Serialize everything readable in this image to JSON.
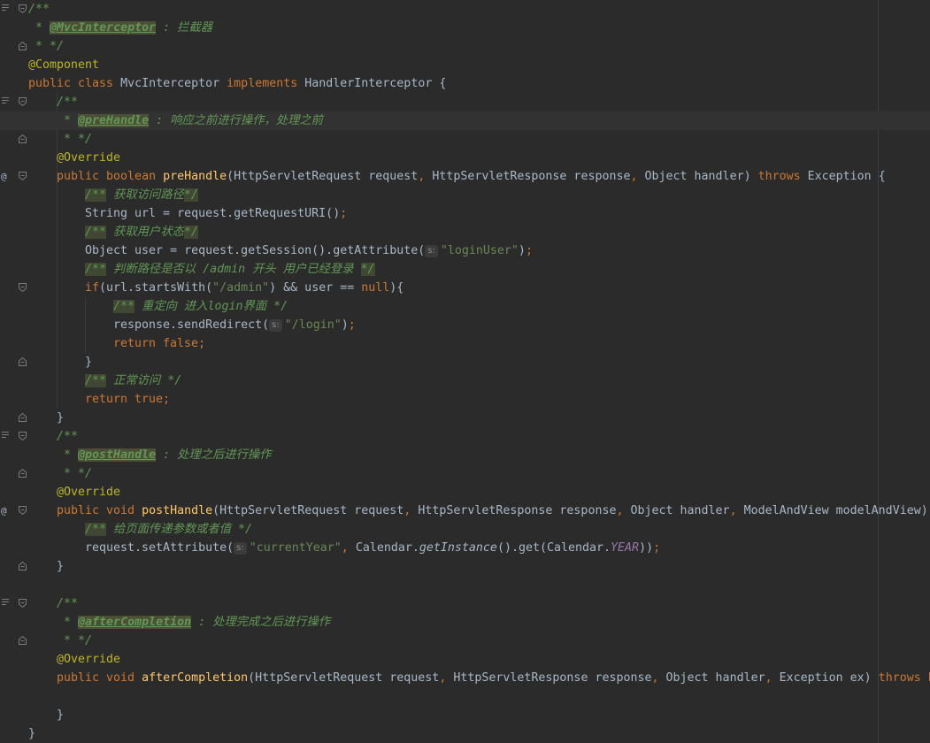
{
  "editor": {
    "lines": [
      {
        "gutter": "doc",
        "fold": "open",
        "indent": 0,
        "tokens": [
          {
            "t": "/**",
            "c": "doc"
          }
        ]
      },
      {
        "indent": 0,
        "tokens": [
          {
            "t": " * ",
            "c": "doc"
          },
          {
            "t": "@MvcInterceptor",
            "c": "doctag"
          },
          {
            "t": " : 拦截器",
            "c": "doc"
          }
        ]
      },
      {
        "fold": "close",
        "indent": 0,
        "tokens": [
          {
            "t": " * */",
            "c": "doc"
          }
        ]
      },
      {
        "indent": 0,
        "tokens": [
          {
            "t": "@Component",
            "c": "ann"
          }
        ]
      },
      {
        "indent": 0,
        "tokens": [
          {
            "t": "public class ",
            "c": "kw"
          },
          {
            "t": "MvcInterceptor "
          },
          {
            "t": "implements ",
            "c": "kw"
          },
          {
            "t": "HandlerInterceptor {"
          }
        ]
      },
      {
        "gutter": "doc",
        "fold": "open",
        "indent": 1,
        "tokens": [
          {
            "t": "/**",
            "c": "doc"
          }
        ]
      },
      {
        "current": true,
        "indent": 1,
        "tokens": [
          {
            "t": " * ",
            "c": "doc"
          },
          {
            "t": "@preHandle",
            "c": "doctag"
          },
          {
            "t": " : 响应之前进行操作，处理之前",
            "c": "doc"
          }
        ]
      },
      {
        "fold": "close",
        "indent": 1,
        "tokens": [
          {
            "t": " * */",
            "c": "doc"
          }
        ]
      },
      {
        "indent": 1,
        "tokens": [
          {
            "t": "@Override",
            "c": "ann"
          }
        ]
      },
      {
        "gutter": "@",
        "fold": "open",
        "indent": 1,
        "tokens": [
          {
            "t": "public boolean ",
            "c": "kw"
          },
          {
            "t": "preHandle",
            "c": "fn"
          },
          {
            "t": "(HttpServletRequest request"
          },
          {
            "t": ", ",
            "c": "kw"
          },
          {
            "t": "HttpServletResponse response"
          },
          {
            "t": ", ",
            "c": "kw"
          },
          {
            "t": "Object handler) "
          },
          {
            "t": "throws ",
            "c": "kw"
          },
          {
            "t": "Exception {"
          }
        ]
      },
      {
        "indent": 2,
        "tokens": [
          {
            "t": "/**",
            "c": "doc docmark"
          },
          {
            "t": " 获取访问路径",
            "c": "doc"
          },
          {
            "t": "*/",
            "c": "doc docmark"
          }
        ]
      },
      {
        "indent": 2,
        "tokens": [
          {
            "t": "String url = request.getRequestURI()"
          },
          {
            "t": ";",
            "c": "kw"
          }
        ]
      },
      {
        "indent": 2,
        "tokens": [
          {
            "t": "/**",
            "c": "doc docmark"
          },
          {
            "t": " 获取用户状态",
            "c": "doc"
          },
          {
            "t": "*/",
            "c": "doc docmark"
          }
        ]
      },
      {
        "indent": 2,
        "tokens": [
          {
            "t": "Object user = request.getSession().getAttribute("
          },
          {
            "hint": "s:"
          },
          {
            "t": "\"loginUser\"",
            "c": "str"
          },
          {
            "t": ")"
          },
          {
            "t": ";",
            "c": "kw"
          }
        ]
      },
      {
        "indent": 2,
        "tokens": [
          {
            "t": "/**",
            "c": "doc docmark"
          },
          {
            "t": " 判断路径是否以 /admin 开头 用户已经登录 ",
            "c": "doc"
          },
          {
            "t": "*/",
            "c": "doc docmark"
          }
        ]
      },
      {
        "fold": "open",
        "indent": 2,
        "tokens": [
          {
            "t": "if",
            "c": "kw"
          },
          {
            "t": "(url.startsWith("
          },
          {
            "t": "\"/admin\"",
            "c": "str"
          },
          {
            "t": ") && user == "
          },
          {
            "t": "null",
            "c": "kw"
          },
          {
            "t": "){"
          }
        ]
      },
      {
        "indent": 3,
        "tokens": [
          {
            "t": "/**",
            "c": "doc docmark"
          },
          {
            "t": " 重定向 进入login界面 ",
            "c": "doc"
          },
          {
            "t": "*/",
            "c": "doc"
          }
        ]
      },
      {
        "indent": 3,
        "tokens": [
          {
            "t": "response.sendRedirect("
          },
          {
            "hint": "s:"
          },
          {
            "t": "\"/login\"",
            "c": "str"
          },
          {
            "t": ")"
          },
          {
            "t": ";",
            "c": "kw"
          }
        ]
      },
      {
        "indent": 3,
        "tokens": [
          {
            "t": "return false;",
            "c": "kw"
          }
        ]
      },
      {
        "fold": "close",
        "indent": 2,
        "tokens": [
          {
            "t": "}"
          }
        ]
      },
      {
        "indent": 2,
        "tokens": [
          {
            "t": "/**",
            "c": "doc docmark"
          },
          {
            "t": " 正常访问 ",
            "c": "doc"
          },
          {
            "t": "*/",
            "c": "doc"
          }
        ]
      },
      {
        "indent": 2,
        "tokens": [
          {
            "t": "return true;",
            "c": "kw"
          }
        ]
      },
      {
        "fold": "close",
        "indent": 1,
        "tokens": [
          {
            "t": "}"
          }
        ]
      },
      {
        "gutter": "doc",
        "fold": "open",
        "indent": 1,
        "tokens": [
          {
            "t": "/**",
            "c": "doc"
          }
        ]
      },
      {
        "indent": 1,
        "tokens": [
          {
            "t": " * ",
            "c": "doc"
          },
          {
            "t": "@postHandle",
            "c": "doctag"
          },
          {
            "t": " : 处理之后进行操作",
            "c": "doc"
          }
        ]
      },
      {
        "fold": "close",
        "indent": 1,
        "tokens": [
          {
            "t": " * */",
            "c": "doc"
          }
        ]
      },
      {
        "indent": 1,
        "tokens": [
          {
            "t": "@Override",
            "c": "ann"
          }
        ]
      },
      {
        "gutter": "@",
        "fold": "open",
        "indent": 1,
        "tokens": [
          {
            "t": "public void ",
            "c": "kw"
          },
          {
            "t": "postHandle",
            "c": "fn"
          },
          {
            "t": "(HttpServletRequest request"
          },
          {
            "t": ", ",
            "c": "kw"
          },
          {
            "t": "HttpServletResponse response"
          },
          {
            "t": ", ",
            "c": "kw"
          },
          {
            "t": "Object handler"
          },
          {
            "t": ", ",
            "c": "kw"
          },
          {
            "t": "ModelAndView modelAndView)"
          }
        ]
      },
      {
        "indent": 2,
        "tokens": [
          {
            "t": "/**",
            "c": "doc docmark"
          },
          {
            "t": " 给页面传递参数或者值 ",
            "c": "doc"
          },
          {
            "t": "*/",
            "c": "doc"
          }
        ]
      },
      {
        "indent": 2,
        "tokens": [
          {
            "t": "request.setAttribute("
          },
          {
            "hint": "s:"
          },
          {
            "t": "\"currentYear\"",
            "c": "str"
          },
          {
            "t": ", ",
            "c": "kw"
          },
          {
            "t": "Calendar."
          },
          {
            "t": "getInstance",
            "c": "static"
          },
          {
            "t": "().get(Calendar."
          },
          {
            "t": "YEAR",
            "c": "fieldc"
          },
          {
            "t": "))"
          },
          {
            "t": ";",
            "c": "kw"
          }
        ]
      },
      {
        "fold": "close",
        "indent": 1,
        "tokens": [
          {
            "t": "}"
          }
        ]
      },
      {
        "indent": 0,
        "tokens": []
      },
      {
        "gutter": "doc",
        "fold": "open",
        "indent": 1,
        "tokens": [
          {
            "t": "/**",
            "c": "doc"
          }
        ]
      },
      {
        "indent": 1,
        "tokens": [
          {
            "t": " * ",
            "c": "doc"
          },
          {
            "t": "@afterCompletion",
            "c": "doctag"
          },
          {
            "t": " : 处理完成之后进行操作",
            "c": "doc"
          }
        ]
      },
      {
        "fold": "close",
        "indent": 1,
        "tokens": [
          {
            "t": " * */",
            "c": "doc"
          }
        ]
      },
      {
        "indent": 1,
        "tokens": [
          {
            "t": "@Override",
            "c": "ann"
          }
        ]
      },
      {
        "indent": 1,
        "tokens": [
          {
            "t": "public void ",
            "c": "kw"
          },
          {
            "t": "afterCompletion",
            "c": "fn"
          },
          {
            "t": "(HttpServletRequest request"
          },
          {
            "t": ", ",
            "c": "kw"
          },
          {
            "t": "HttpServletResponse response"
          },
          {
            "t": ", ",
            "c": "kw"
          },
          {
            "t": "Object handler"
          },
          {
            "t": ", ",
            "c": "kw"
          },
          {
            "t": "Exception ex) "
          },
          {
            "t": "throws E",
            "c": "kw"
          }
        ]
      },
      {
        "indent": 0,
        "tokens": []
      },
      {
        "indent": 1,
        "tokens": [
          {
            "t": "}"
          }
        ]
      },
      {
        "indent": 0,
        "tokens": [
          {
            "t": "}"
          }
        ]
      }
    ]
  },
  "colors": {
    "background": "#2b2b2b",
    "keyword": "#cc7832",
    "annotation": "#bbb529",
    "string": "#6a8759",
    "doc_comment": "#629755",
    "method_declaration": "#ffc66d",
    "default_text": "#a9b7c6",
    "static_field": "#9876aa"
  },
  "icons": {
    "doc_render": "doc-render-icon",
    "override": "override-at-icon",
    "fold": "fold-marker-icon"
  }
}
